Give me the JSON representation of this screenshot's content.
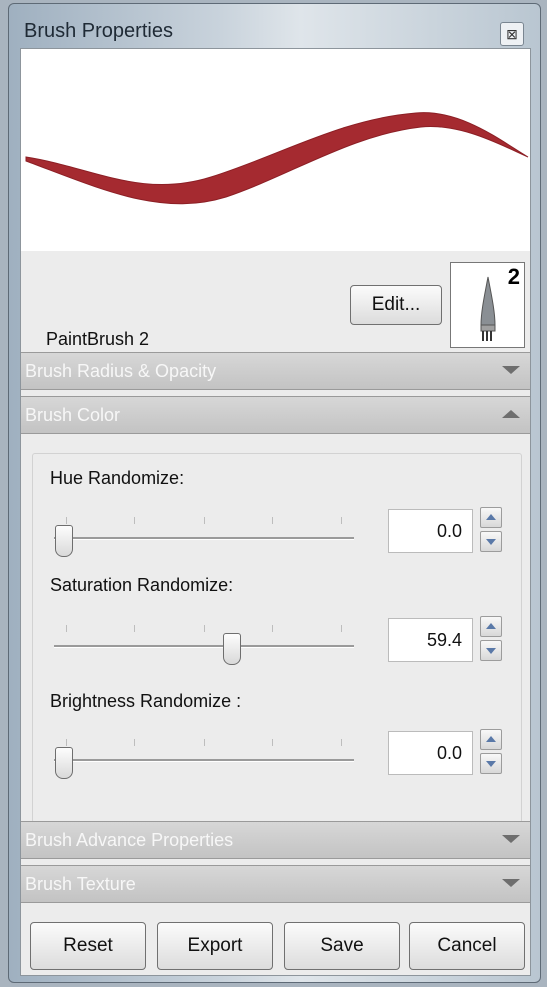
{
  "window": {
    "title": "Brush Properties",
    "close_glyph": "⊠"
  },
  "brush": {
    "name": "PaintBrush 2",
    "edit_label": "Edit...",
    "tip_number": "2",
    "stroke_color": "#a52a30"
  },
  "sections": {
    "radius_opacity": {
      "label": "Brush Radius & Opacity",
      "state": "collapsed"
    },
    "color": {
      "label": "Brush Color",
      "state": "expanded"
    },
    "advance": {
      "label": "Brush Advance Properties",
      "state": "collapsed"
    },
    "texture": {
      "label": "Brush Texture",
      "state": "collapsed"
    }
  },
  "color_fields": [
    {
      "label": "Hue Randomize:",
      "value": "0.0",
      "fraction": 0.0
    },
    {
      "label": "Saturation Randomize:",
      "value": "59.4",
      "fraction": 0.594
    },
    {
      "label": "Brightness Randomize :",
      "value": "0.0",
      "fraction": 0.0
    }
  ],
  "footer": {
    "reset_label": "Reset",
    "export_label": "Export",
    "save_label": "Save",
    "cancel_label": "Cancel"
  }
}
